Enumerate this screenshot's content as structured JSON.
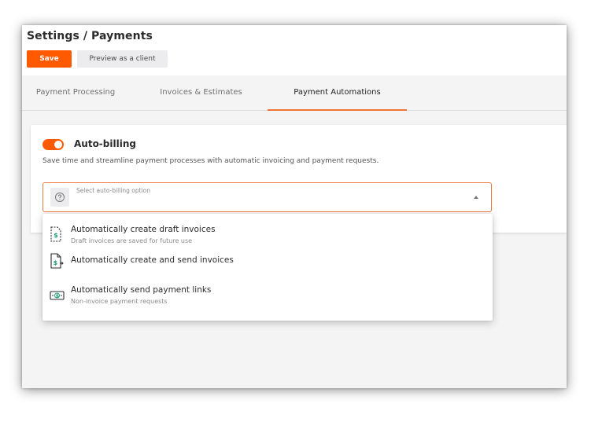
{
  "header": {
    "title": "Settings / Payments",
    "save_label": "Save",
    "preview_label": "Preview as a client"
  },
  "tabs": [
    {
      "label": "Payment Processing",
      "active": false
    },
    {
      "label": "Invoices & Estimates",
      "active": false
    },
    {
      "label": "Payment Automations",
      "active": true
    }
  ],
  "autobilling": {
    "enabled": true,
    "title": "Auto-billing",
    "description": "Save time and streamline payment processes with automatic invoicing and payment requests.",
    "select": {
      "placeholder": "Select auto-billing option",
      "icon": "question-circle-icon"
    },
    "options": [
      {
        "title": "Automatically create draft invoices",
        "subtitle": "Draft invoices are saved for future use",
        "icon": "draft-invoice-icon"
      },
      {
        "title": "Automatically create and send invoices",
        "subtitle": "",
        "icon": "send-invoice-icon"
      },
      {
        "title": "Automatically send payment links",
        "subtitle": "Non-invoice payment requests",
        "icon": "payment-link-icon"
      }
    ]
  },
  "colors": {
    "accent": "#ff5a00",
    "border_focus": "#ef7a3e",
    "icon_green": "#1f9c7a"
  }
}
